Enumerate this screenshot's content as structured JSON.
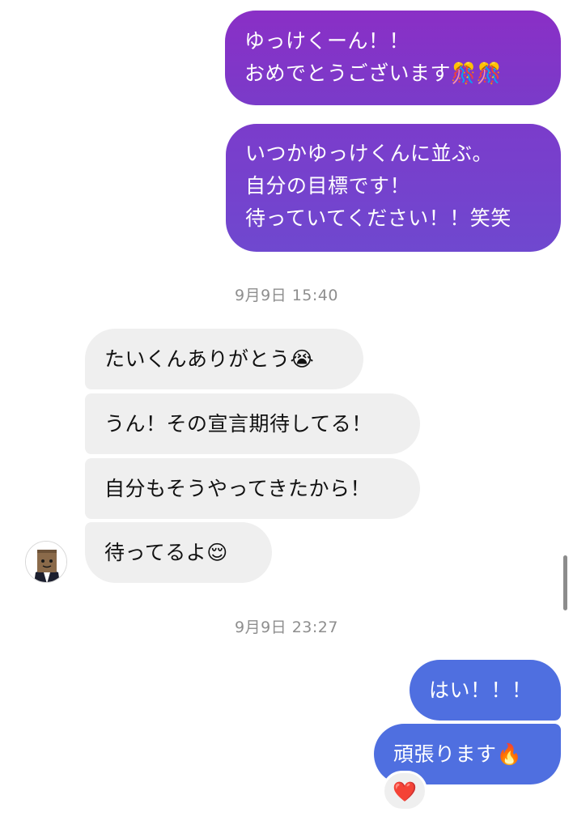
{
  "messages": {
    "sent_1": {
      "lines": [
        "ゆっけくーん！！",
        "おめでとうございます🎊🎊"
      ]
    },
    "sent_2": {
      "lines": [
        "いつかゆっけくんに並ぶ。",
        "自分の目標です！",
        "待っていてください！！笑笑"
      ]
    },
    "timestamp_1": "9月9日 15:40",
    "received_1": "たいくんありがとう😭",
    "received_2": "うん！その宣言期待してる！",
    "received_3": "自分もそうやってきたから！",
    "received_4": "待ってるよ😌",
    "timestamp_2": "9月9日 23:27",
    "sent_3": "はい！！！",
    "sent_4": "頑張ります🔥",
    "reaction": "❤️"
  },
  "colors": {
    "sent_purple": "#8a2fc6",
    "sent_blue": "#4f6fe0",
    "received_bg": "#efefef",
    "timestamp_text": "#8e8e8e"
  },
  "icons": {
    "avatar": "avatar-icon",
    "reaction": "heart-icon"
  }
}
